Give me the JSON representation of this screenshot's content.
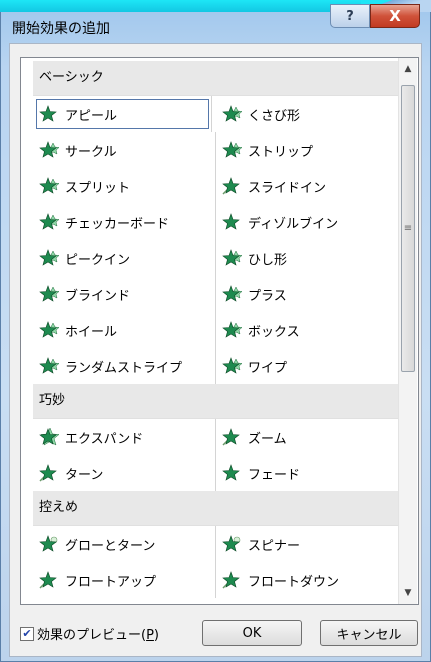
{
  "window": {
    "title": "開始効果の追加",
    "help_label": "?",
    "close_label": "X"
  },
  "categories": [
    {
      "label": "ベーシック",
      "items": [
        {
          "label": "アピール",
          "icon": "star-green-icon",
          "selected": true
        },
        {
          "label": "くさび形",
          "icon": "star-burst-icon"
        },
        {
          "label": "サークル",
          "icon": "star-burst-icon"
        },
        {
          "label": "ストリップ",
          "icon": "star-burst-icon"
        },
        {
          "label": "スプリット",
          "icon": "star-burst-icon"
        },
        {
          "label": "スライドイン",
          "icon": "star-fly-icon"
        },
        {
          "label": "チェッカーボード",
          "icon": "star-burst-icon"
        },
        {
          "label": "ディゾルブイン",
          "icon": "star-green-icon"
        },
        {
          "label": "ピークイン",
          "icon": "star-burst-icon"
        },
        {
          "label": "ひし形",
          "icon": "star-burst-icon"
        },
        {
          "label": "ブラインド",
          "icon": "star-burst-icon"
        },
        {
          "label": "プラス",
          "icon": "star-burst-icon"
        },
        {
          "label": "ホイール",
          "icon": "star-burst-icon"
        },
        {
          "label": "ボックス",
          "icon": "star-burst-icon"
        },
        {
          "label": "ランダムストライプ",
          "icon": "star-burst-icon"
        },
        {
          "label": "ワイプ",
          "icon": "star-burst-icon"
        }
      ]
    },
    {
      "label": "巧妙",
      "items": [
        {
          "label": "エクスパンド",
          "icon": "star-expand-icon"
        },
        {
          "label": "ズーム",
          "icon": "star-fly-icon"
        },
        {
          "label": "ターン",
          "icon": "star-fly-icon"
        },
        {
          "label": "フェード",
          "icon": "star-green-icon"
        }
      ]
    },
    {
      "label": "控えめ",
      "items": [
        {
          "label": "グローとターン",
          "icon": "star-glow-icon"
        },
        {
          "label": "スピナー",
          "icon": "star-glow-icon"
        },
        {
          "label": "フロートアップ",
          "icon": "star-fly-icon"
        },
        {
          "label": "フロートダウン",
          "icon": "star-fly-icon"
        }
      ]
    }
  ],
  "footer": {
    "preview_label": "効果のプレビュー(",
    "preview_accel": "P",
    "preview_close": ")",
    "preview_checked": true,
    "ok_label": "OK",
    "cancel_label": "キャンセル"
  },
  "colors": {
    "star": "#1e8a4f",
    "star_light": "#8fd9a8",
    "accent": "#5577aa"
  }
}
